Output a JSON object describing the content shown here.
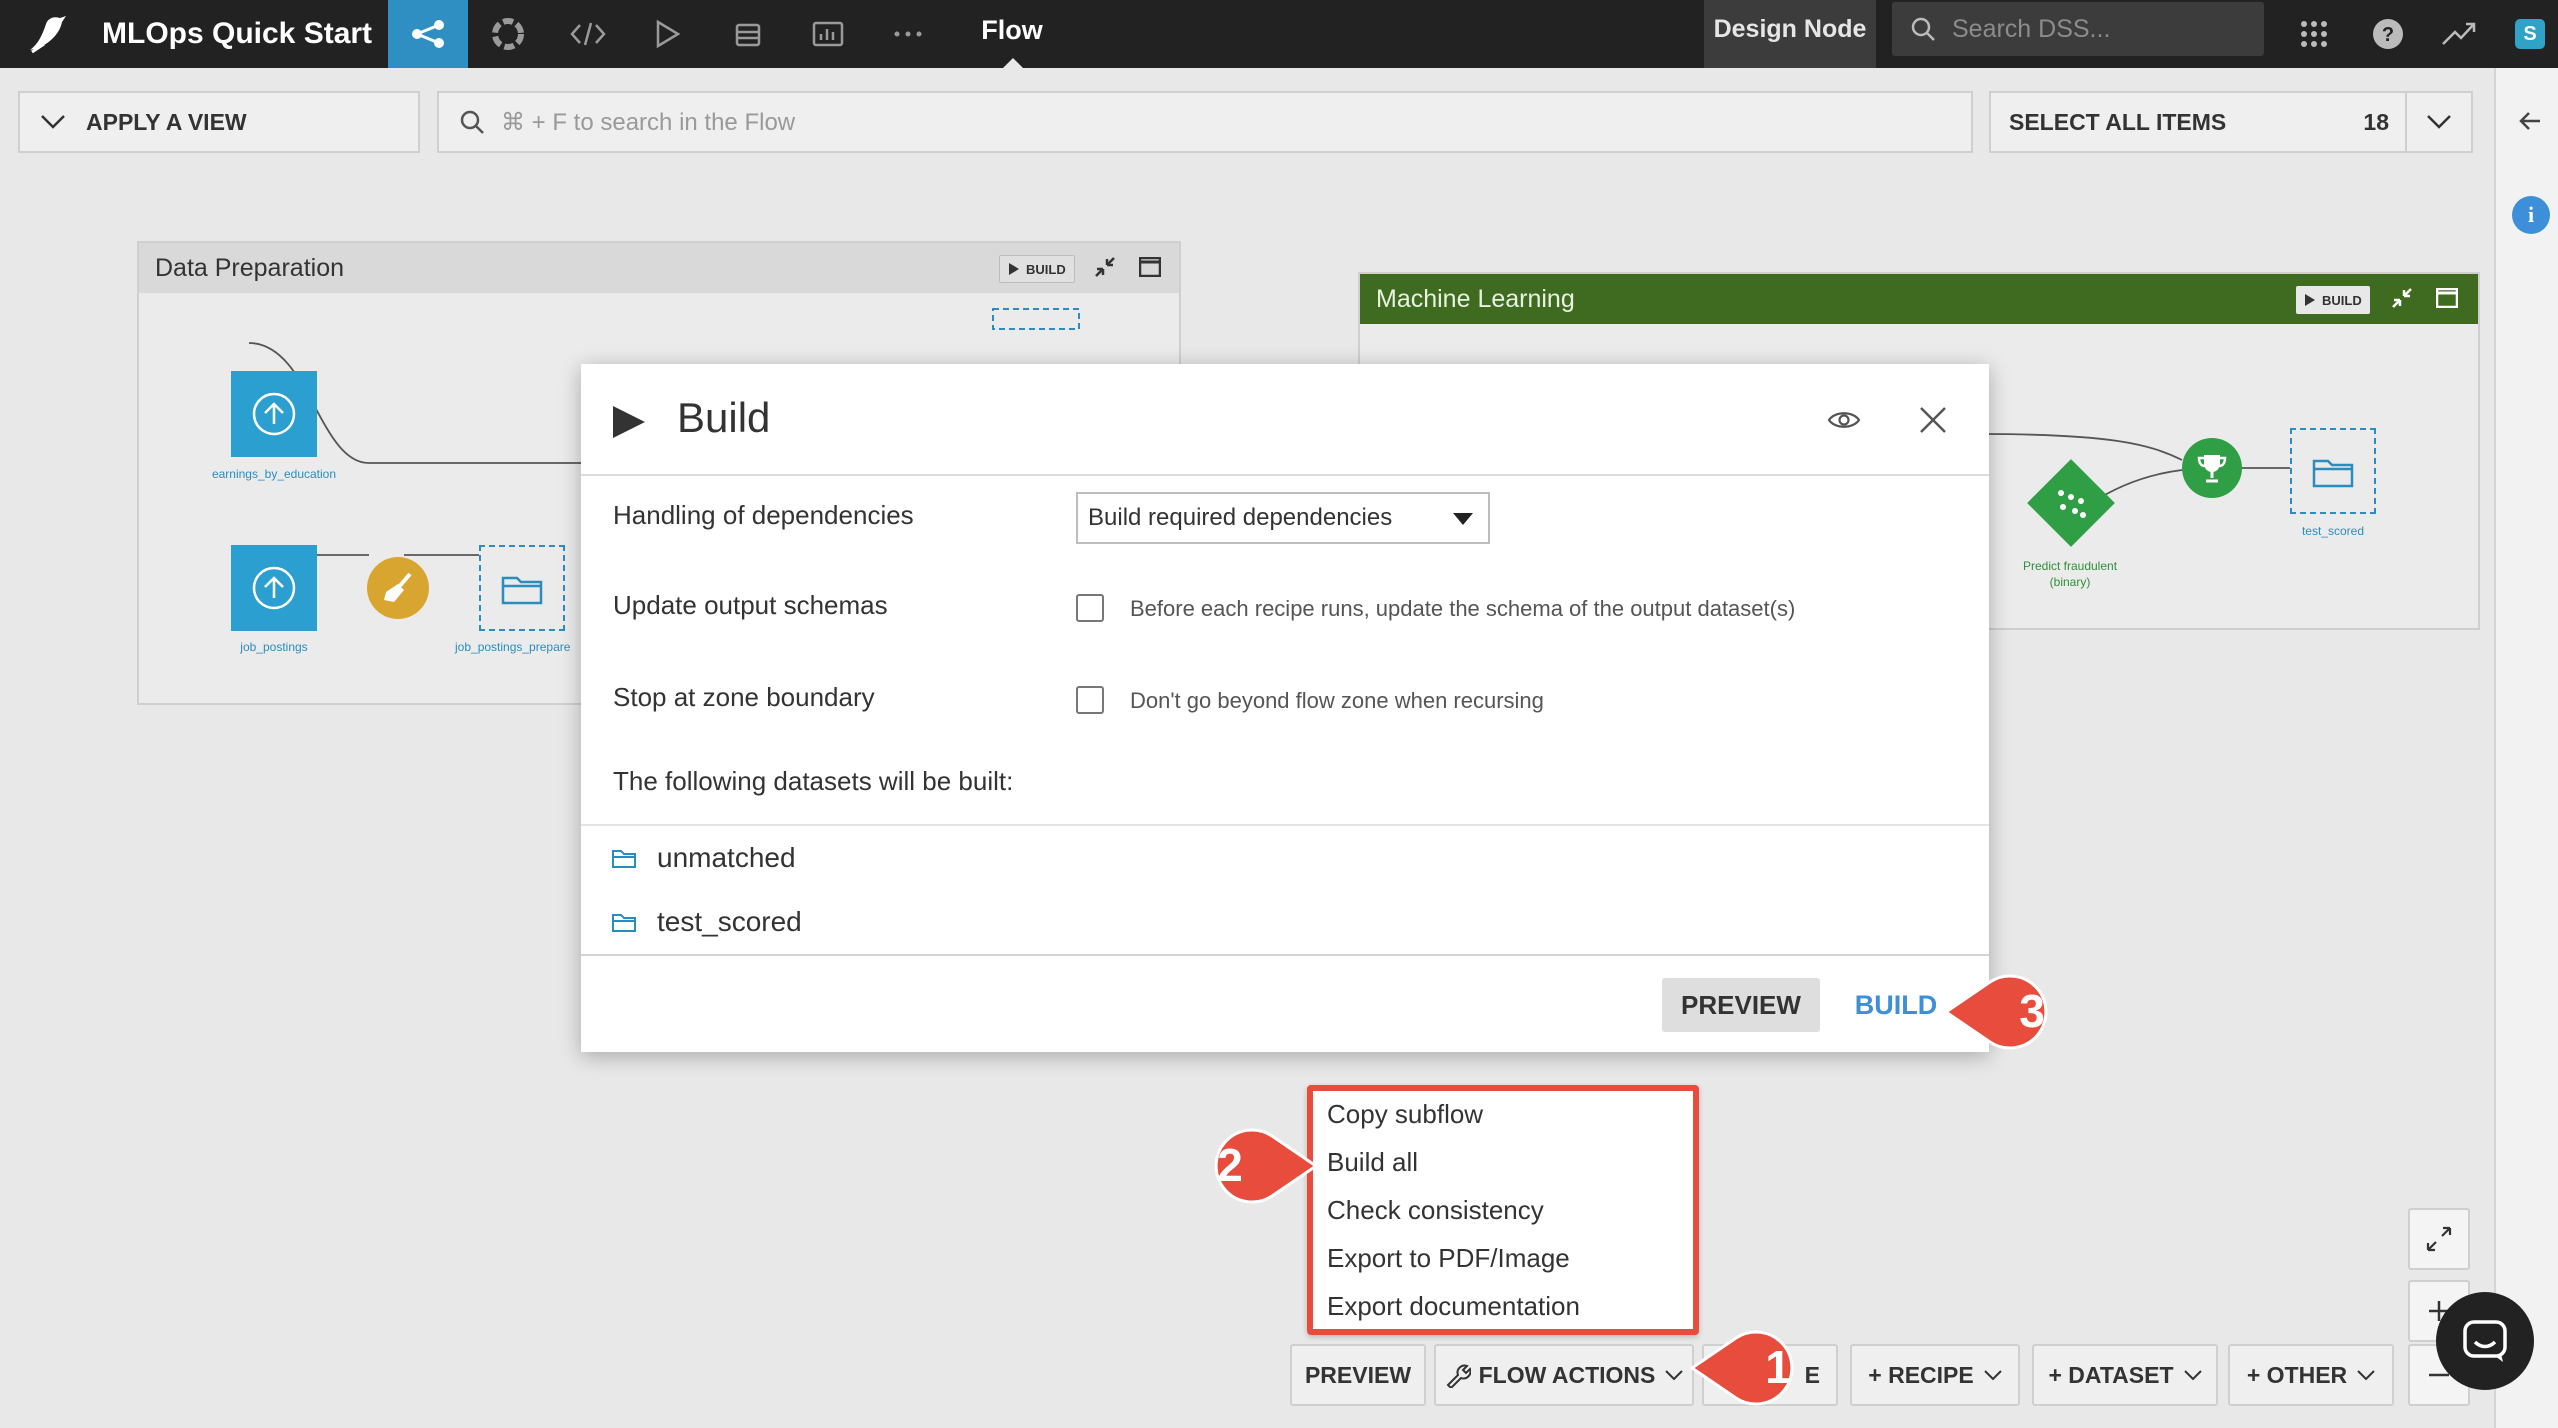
{
  "topbar": {
    "app_title": "MLOps Quick Start",
    "flow_tab": "Flow",
    "design_node": "Design Node",
    "search_placeholder": "Search DSS...",
    "avatar_initial": "S",
    "active_color": "#2f8fc3"
  },
  "toolbar": {
    "apply_view": "APPLY A VIEW",
    "flow_search_placeholder": "⌘ + F to search in the Flow",
    "select_all": "SELECT ALL ITEMS",
    "item_count": "18"
  },
  "zones": {
    "data_prep": {
      "title": "Data Preparation",
      "build": "BUILD",
      "datasets": [
        "earnings_by_education",
        "job_postings",
        "job_postings_prepare"
      ]
    },
    "ml": {
      "title": "Machine Learning",
      "build": "BUILD",
      "header_color": "#3f6b21",
      "model_label_line1": "Predict fraudulent",
      "model_label_line2": "(binary)",
      "output_dataset": "test_scored"
    }
  },
  "modal": {
    "title": "Build",
    "dependencies_label": "Handling of dependencies",
    "dependencies_value": "Build required dependencies",
    "schemas_label": "Update output schemas",
    "schemas_hint": "Before each recipe runs, update the schema of the output dataset(s)",
    "stop_label": "Stop at zone boundary",
    "stop_hint": "Don't go beyond flow zone when recursing",
    "datasets_heading": "The following datasets will be built:",
    "datasets": [
      "unmatched",
      "test_scored"
    ],
    "preview_label": "PREVIEW",
    "build_label": "BUILD"
  },
  "flow_menu": {
    "items": [
      "Copy subflow",
      "Build all",
      "Check consistency",
      "Export to PDF/Image",
      "Export documentation"
    ]
  },
  "bottom_bar": {
    "preview": "PREVIEW",
    "flow_actions": "FLOW ACTIONS",
    "hidden_partial": "E",
    "recipe": "+ RECIPE",
    "dataset": "+ DATASET",
    "other": "+ OTHER"
  },
  "callouts": [
    "1",
    "2",
    "3"
  ],
  "colors": {
    "callout": "#e74c3c",
    "dataset_blue": "#2b8cbe",
    "recipe_yellow": "#d9a531",
    "model_green": "#2f9e44"
  }
}
